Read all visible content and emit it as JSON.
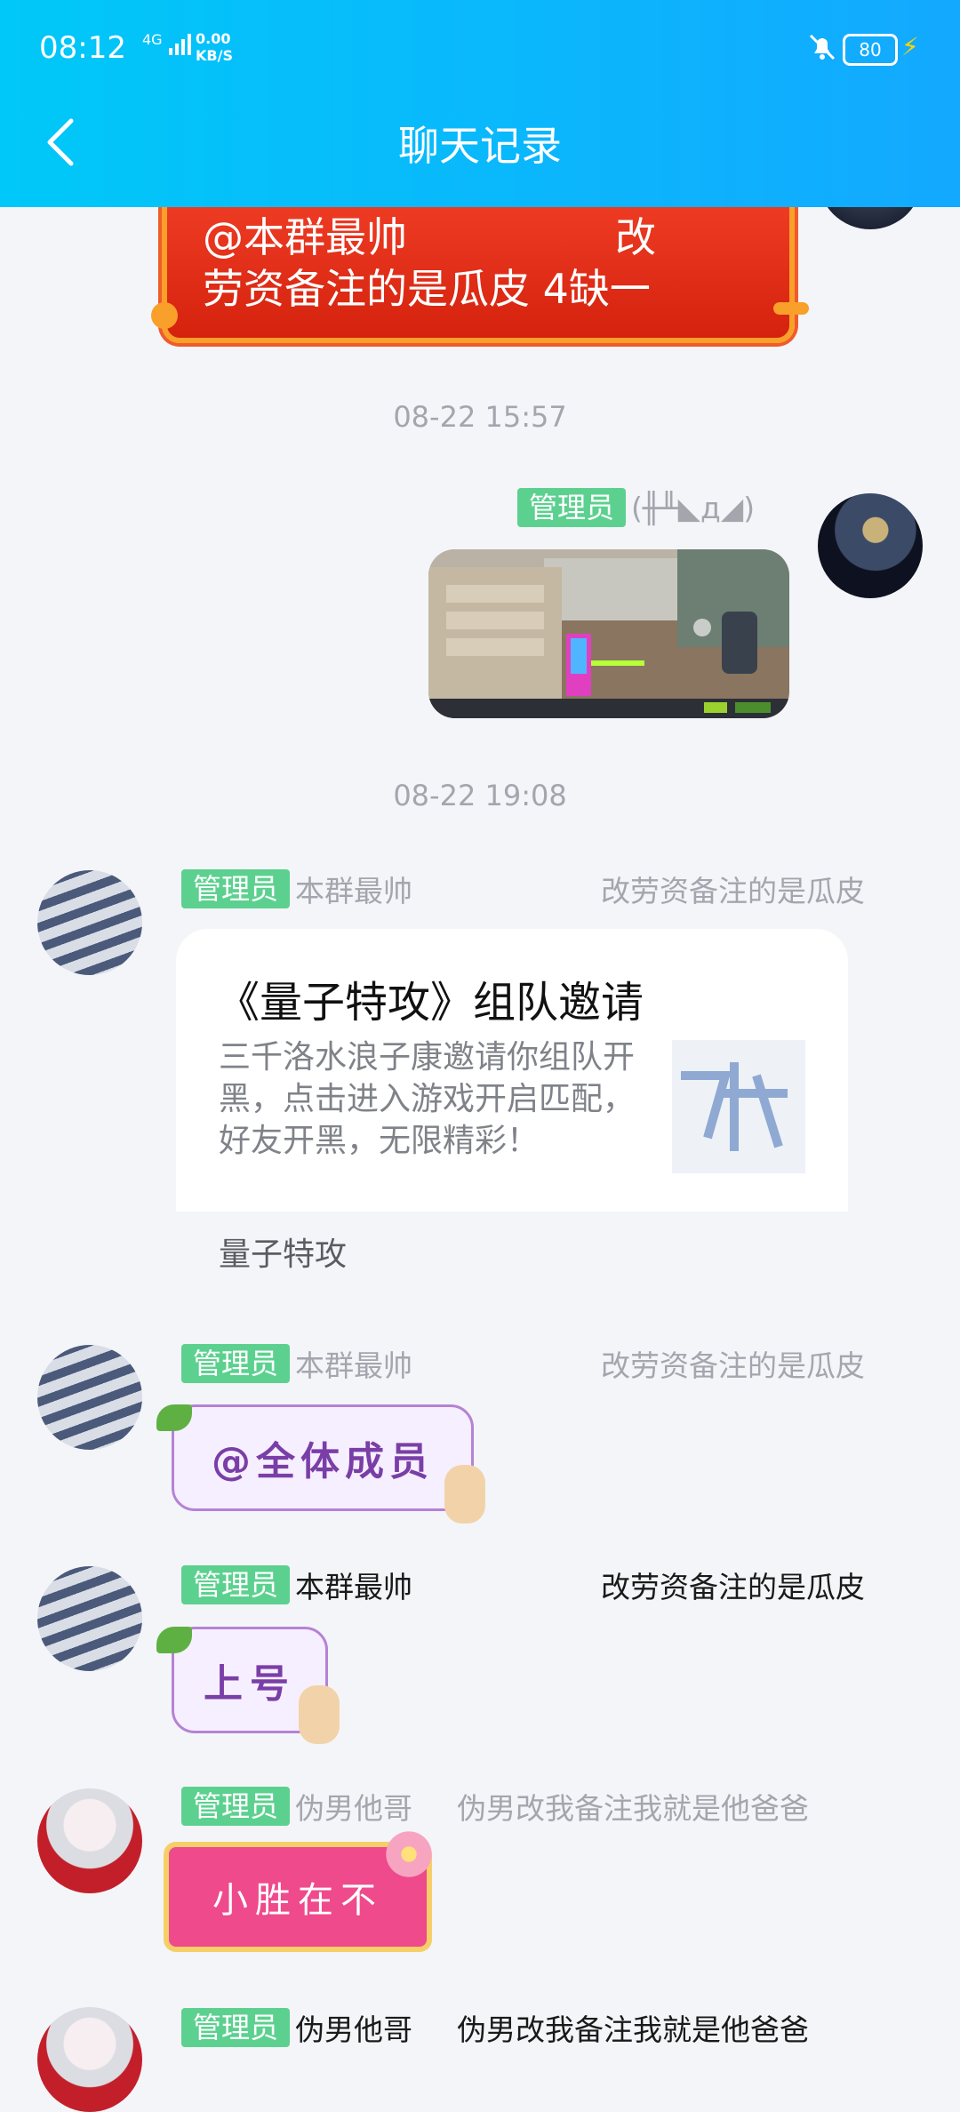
{
  "status_bar": {
    "time": "08:12",
    "network_top": "4G",
    "network_bottom": "",
    "speed_value": "0.00",
    "speed_unit": "KB/S",
    "battery": "80",
    "bell_icon": "bell-muted-icon",
    "charge_icon": "charging-bolt-icon"
  },
  "header": {
    "title": "聊天记录",
    "back_icon": "back-chevron-icon",
    "background_colors": [
      "#00c8f8",
      "#13a9ff"
    ]
  },
  "messages": [
    {
      "kind": "red-bubble",
      "line1": "@本群最帅                改",
      "line2": "劳资备注的是瓜皮 4缺一"
    },
    {
      "kind": "timestamp",
      "text": "08-22 15:57"
    },
    {
      "kind": "image-outgoing",
      "badge": "管理员",
      "sender": "(╫╨◣д◢)"
    },
    {
      "kind": "timestamp",
      "text": "08-22 19:08"
    },
    {
      "kind": "card",
      "badge": "管理员",
      "sender": "本群最帅",
      "alias": "改劳资备注的是瓜皮",
      "title": "《量子特攻》组队邀请",
      "description": "三千洛水浪子康邀请你组队开黑，点击进入游戏开启匹配，好友开黑，无限精彩！",
      "footer": "量子特攻"
    },
    {
      "kind": "sticker-purple",
      "badge": "管理员",
      "sender": "本群最帅",
      "alias": "改劳资备注的是瓜皮",
      "text": "@全体成员"
    },
    {
      "kind": "sticker-purple",
      "badge": "管理员",
      "sender": "本群最帅",
      "alias": "改劳资备注的是瓜皮",
      "text": "上号"
    },
    {
      "kind": "sticker-pink",
      "badge": "管理员",
      "sender": "伪男他哥",
      "alias": "伪男改我备注我就是他爸爸",
      "text": "小胜在不"
    },
    {
      "kind": "partial",
      "badge": "管理员",
      "sender": "伪男他哥",
      "alias": "伪男改我备注我就是他爸爸"
    }
  ],
  "colors": {
    "admin_badge": "#5cd18f",
    "timestamp": "#a3a6ad",
    "chat_background": "#f4f5f9"
  }
}
